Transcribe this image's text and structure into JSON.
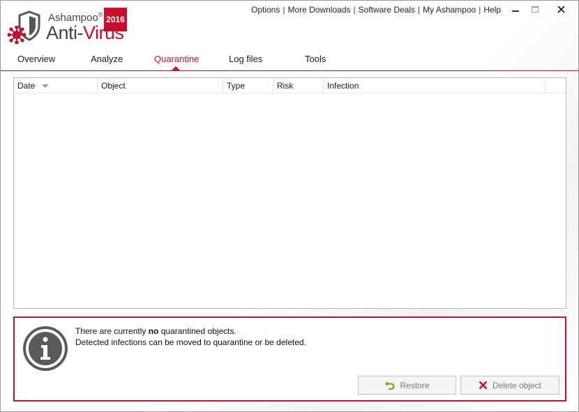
{
  "app": {
    "brand": "Ashampoo",
    "brand_mark": "®",
    "product_prefix": "Anti-",
    "product_suffix": "Virus",
    "year": "2016"
  },
  "top_links": [
    "Options",
    "More Downloads",
    "Software Deals",
    "My Ashampoo",
    "Help"
  ],
  "top_link_separator": "|",
  "tabs": [
    "Overview",
    "Analyze",
    "Quarantine",
    "Log files",
    "Tools"
  ],
  "active_tab": "Quarantine",
  "table": {
    "columns": [
      "Date",
      "Object",
      "Type",
      "Risk",
      "Infection"
    ],
    "rows": []
  },
  "info": {
    "line1_before": "There are currently ",
    "line1_bold": "no",
    "line1_after": " quarantined objects.",
    "line2": "Detected infections can be moved to quarantine or be deleted."
  },
  "buttons": {
    "restore": "Restore",
    "delete": "Delete object"
  },
  "icons": {
    "restore": "undo-arrow-icon",
    "delete": "red-x-icon",
    "info": "info-icon"
  },
  "colors": {
    "accent": "#c8102e",
    "info_icon": "#5a5a5a",
    "restore_icon": "#7ba21f"
  }
}
